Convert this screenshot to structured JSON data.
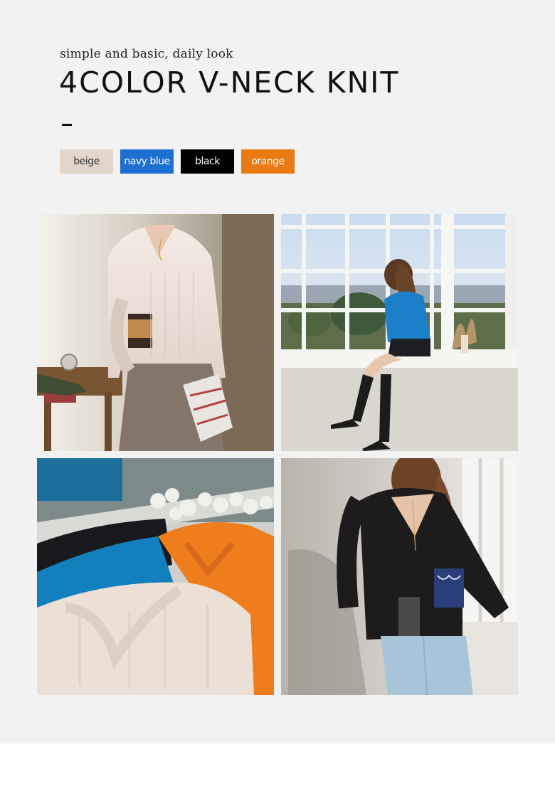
{
  "header": {
    "tagline": "simple and basic, daily look",
    "title": "4COLOR V-NECK KNIT",
    "dash": "-"
  },
  "colors": [
    {
      "label": "beige",
      "bg": "#e3d6c8",
      "fg": "#333333"
    },
    {
      "label": "navy blue",
      "bg": "#1d6fd0",
      "fg": "#ffffff"
    },
    {
      "label": "black",
      "bg": "#000000",
      "fg": "#ffffff"
    },
    {
      "label": "orange",
      "bg": "#ea7a12",
      "fg": "#ffffff"
    }
  ],
  "photos": [
    {
      "name": "beige-knit-photo",
      "subject": "model in beige v-neck knit holding a coffee cup"
    },
    {
      "name": "navy-knit-photo",
      "subject": "model in blue knit sitting by the window"
    },
    {
      "name": "color-lineup-photo",
      "subject": "folded knits in four colors with cotton flowers"
    },
    {
      "name": "black-knit-photo",
      "subject": "model in black knit holding a cup by the window"
    }
  ]
}
